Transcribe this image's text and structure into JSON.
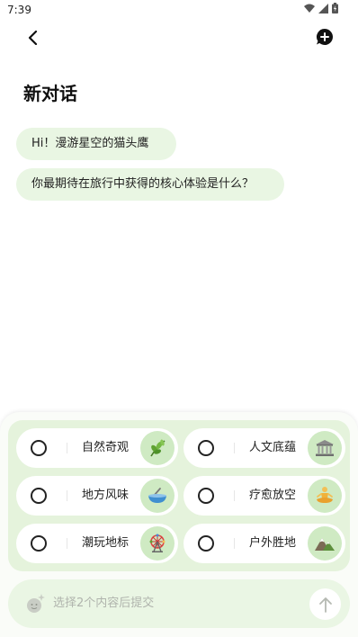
{
  "status_bar": {
    "time": "7:39",
    "icons": [
      "wifi-icon",
      "signal-icon",
      "battery-icon"
    ]
  },
  "header": {
    "back_icon": "chevron-left-icon",
    "new_chat_icon": "chat-plus-icon"
  },
  "page": {
    "title": "新对话"
  },
  "messages": [
    {
      "text": "Hi！漫游星空的猫头鹰"
    },
    {
      "text": "你最期待在旅行中获得的核心体验是什么？"
    }
  ],
  "options": [
    {
      "label": "自然奇观",
      "icon": "leaf-icon"
    },
    {
      "label": "人文底蕴",
      "icon": "museum-icon"
    },
    {
      "label": "地方风味",
      "icon": "food-bowl-icon"
    },
    {
      "label": "疗愈放空",
      "icon": "meditation-icon"
    },
    {
      "label": "潮玩地标",
      "icon": "ferris-wheel-icon"
    },
    {
      "label": "户外胜地",
      "icon": "mountain-icon"
    }
  ],
  "composer": {
    "placeholder": "选择2个内容后提交",
    "emoji_icon": "sparkle-face-icon",
    "send_icon": "arrow-up-icon"
  },
  "colors": {
    "accent_light": "#e9f6e3",
    "panel": "#e5f3dc",
    "icon_bg": "#cfeac3"
  }
}
